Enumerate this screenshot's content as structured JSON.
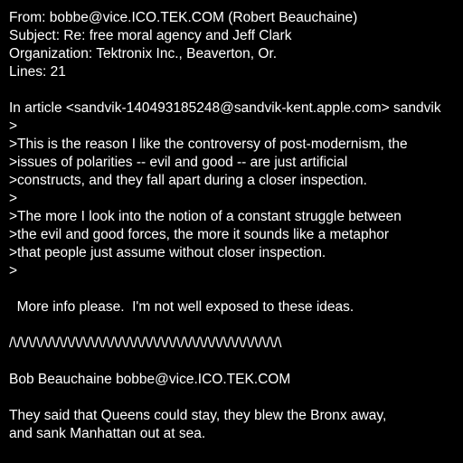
{
  "header": {
    "from": "From: bobbe@vice.ICO.TEK.COM (Robert Beauchaine)",
    "subject": "Subject: Re: free moral agency and Jeff Clark",
    "organization": "Organization: Tektronix Inc., Beaverton, Or.",
    "lines": "Lines: 21"
  },
  "attribution": "In article <sandvik-140493185248@sandvik-kent.apple.com> sandvik",
  "quoted": [
    ">",
    ">This is the reason I like the controversy of post-modernism, the",
    ">issues of polarities -- evil and good -- are just artificial",
    ">constructs, and they fall apart during a closer inspection.",
    ">",
    ">The more I look into the notion of a constant struggle between",
    ">the evil and good forces, the more it sounds like a metaphor",
    ">that people just assume without closer inspection.",
    ">"
  ],
  "reply": "  More info please.  I'm not well exposed to these ideas.",
  "separator": "/\\/\\/\\/\\/\\/\\/\\/\\/\\/\\/\\/\\/\\/\\/\\/\\/\\/\\/\\/\\/\\/\\/\\/\\/\\/\\/\\/\\/\\/\\/\\/\\/\\/\\/\\",
  "signature": {
    "name_email": "Bob Beauchaine bobbe@vice.ICO.TEK.COM",
    "quote_line1": "They said that Queens could stay, they blew the Bronx away,",
    "quote_line2": "and sank Manhattan out at sea."
  },
  "colors": {
    "background": "#000000",
    "text": "#ffffff"
  }
}
